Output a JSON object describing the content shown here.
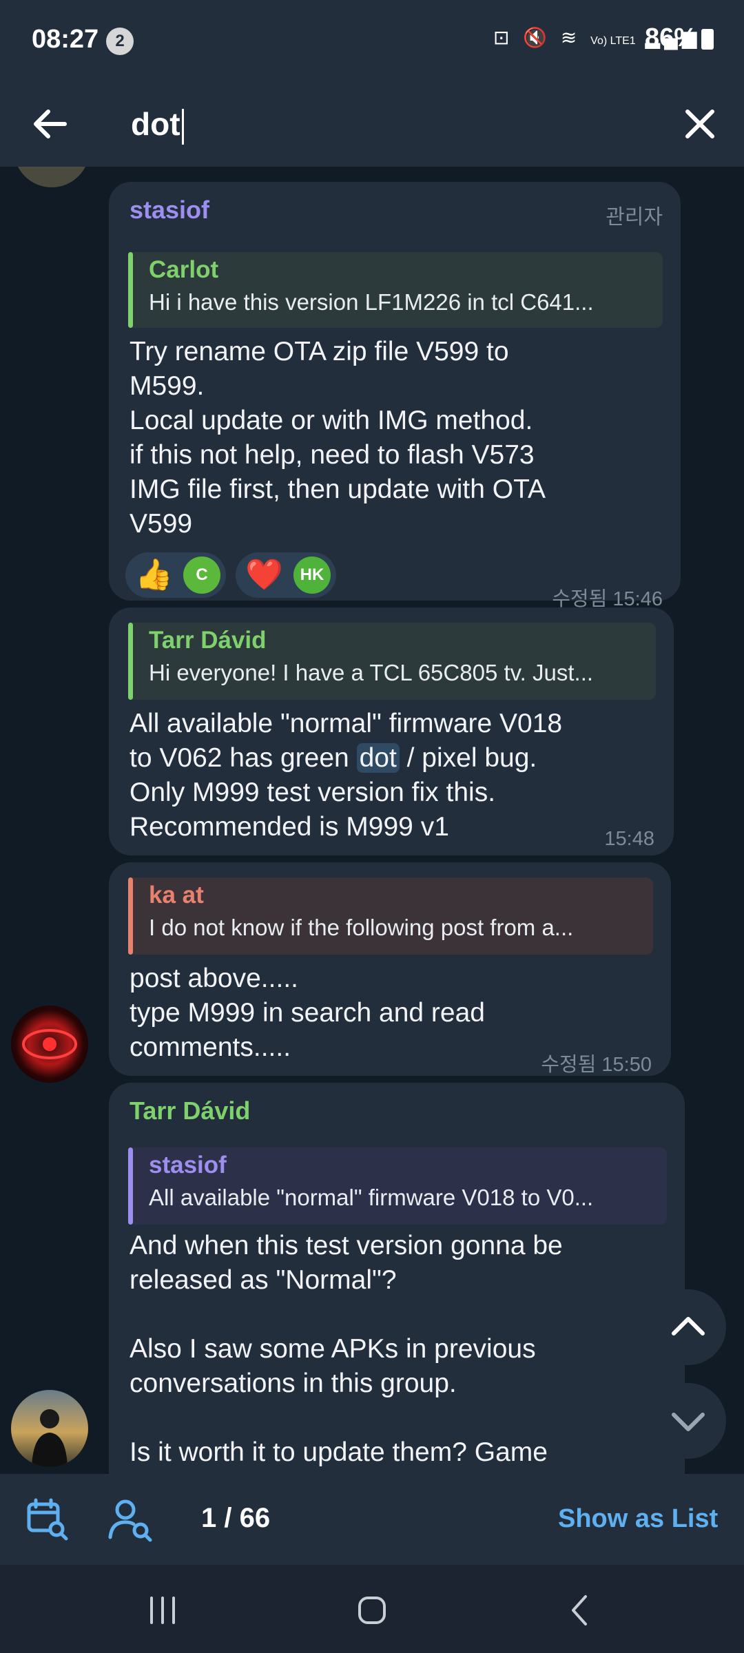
{
  "status_bar": {
    "time": "08:27",
    "notification_count": "2",
    "signal_label": "Vo) LTE1",
    "battery": "86%"
  },
  "search": {
    "query": "dot"
  },
  "messages": [
    {
      "sender": "stasiof",
      "role_badge": "관리자",
      "reply": {
        "name": "Carlot",
        "text": "Hi i have this version LF1M226 in tcl C641..."
      },
      "text": "Try rename OTA zip file V599 to\nM599.\nLocal update or with IMG method.\nif this not help, need to flash V573\nIMG file first, then update with OTA\nV599",
      "reactions": [
        {
          "emoji": "👍",
          "avatar": "C"
        },
        {
          "emoji": "❤️",
          "avatar": "HK"
        }
      ],
      "time": "수정됨 15:46"
    },
    {
      "reply": {
        "name": "Tarr Dávid",
        "text": "Hi everyone! I have a TCL 65C805 tv. Just..."
      },
      "text_before": "All available \"normal\" firmware V018\nto V062 has green ",
      "highlight": "dot",
      "text_after": " / pixel bug.\nOnly M999 test version fix this.\nRecommended is M999 v1",
      "time": "15:48"
    },
    {
      "reply": {
        "name": "ka at",
        "text": "I do not know if the following post from a..."
      },
      "text": "post above.....\ntype M999 in search and read\ncomments.....",
      "time": "수정됨 15:50"
    },
    {
      "sender": "Tarr Dávid",
      "reply": {
        "name": "stasiof",
        "text": "All available \"normal\" firmware V018 to V0..."
      },
      "text": "And when this test version gonna be\nreleased as \"Normal\"?\n\nAlso I saw some APKs in previous\nconversations in this group.\n\nIs it worth it to update them? Game"
    }
  ],
  "bottom_bar": {
    "counter": "1 / 66",
    "show_as_list": "Show as List"
  },
  "colors": {
    "header": "#232e3c",
    "chat_bg": "#111b26",
    "bubble": "#232e3c",
    "accent_purple": "#9d8ff0",
    "accent_green": "#7fd16c",
    "accent_salmon": "#e8826f",
    "link_blue": "#5fb0f0"
  }
}
